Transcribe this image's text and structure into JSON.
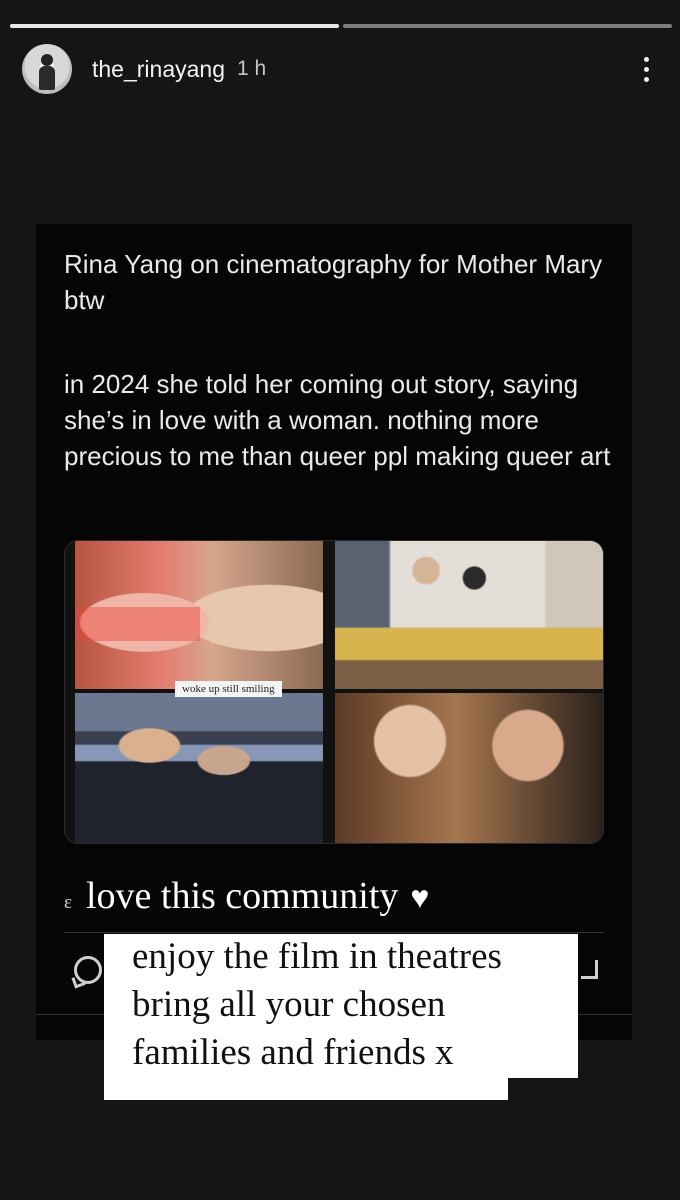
{
  "progress": {
    "segments": 2,
    "current": 1
  },
  "header": {
    "username": "the_rinayang",
    "time": "1 h"
  },
  "tweet": {
    "paragraph1": "Rina Yang on cinematography for Mother Mary btw",
    "paragraph2": "in 2024 she told her coming out story, saying she’s in love with a woman. nothing more precious to me than queer ppl making queer art",
    "collage_caption": "woke up still smiling"
  },
  "reply": {
    "prefix": "ε",
    "text": "love this community",
    "heart": "♥"
  },
  "sticker": {
    "line1": "enjoy the film in theatres",
    "line2": "bring all your chosen",
    "line3": "families and friends x"
  },
  "colors": {
    "background": "#151515",
    "card": "#050505",
    "sticker": "#ffffff"
  },
  "icons": [
    "more-icon",
    "comment-icon",
    "share-icon",
    "heart-icon"
  ]
}
